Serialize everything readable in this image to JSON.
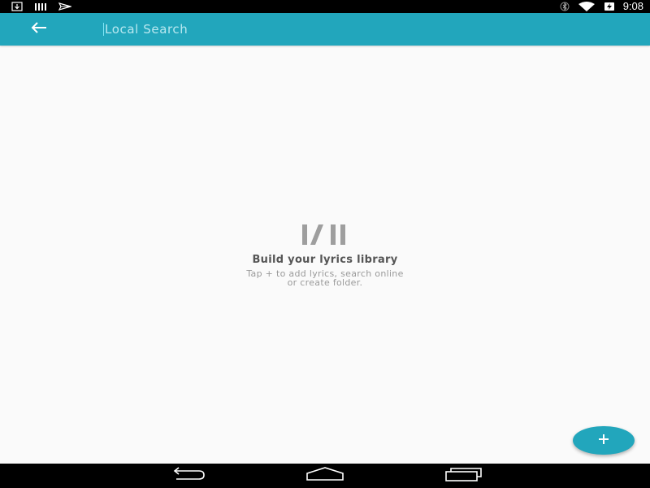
{
  "status_bar": {
    "time": "9:08",
    "icons_left": [
      "download-icon",
      "signal-bars-icon",
      "send-icon"
    ],
    "icons_right": [
      "bluetooth-icon",
      "wifi-icon",
      "battery-charging-icon"
    ]
  },
  "app_bar": {
    "back_icon": "arrow-left-icon",
    "search_placeholder": "Local Search",
    "search_value": ""
  },
  "empty_state": {
    "logo_icon": "lyrics-logo-icon",
    "title": "Build your lyrics library",
    "subtitle_line1": "Tap + to add lyrics, search online",
    "subtitle_line2": "or create folder."
  },
  "fab": {
    "icon": "plus-icon"
  },
  "nav_bar": {
    "back_icon": "nav-back-icon",
    "home_icon": "nav-home-icon",
    "recents_icon": "nav-recents-icon"
  },
  "colors": {
    "accent": "#22a6bc",
    "background": "#fafafa",
    "system_bar": "#000000",
    "title_text": "#555555",
    "subtitle_text": "#9a9a9a"
  }
}
